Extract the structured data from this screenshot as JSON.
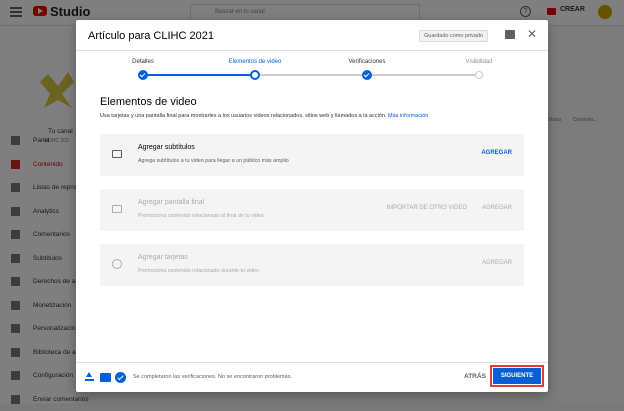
{
  "app": {
    "logo_text": "Studio",
    "search_placeholder": "Buscar en tu canal",
    "create_label": "CREAR"
  },
  "channel": {
    "name": "Tu canal",
    "subname": "CLIHC 202"
  },
  "sidebar": {
    "items": [
      {
        "label": "Panel",
        "icon": "dashboard-icon"
      },
      {
        "label": "Contenido",
        "icon": "content-icon",
        "active": true
      },
      {
        "label": "Listas de repro",
        "icon": "playlist-icon"
      },
      {
        "label": "Analytics",
        "icon": "analytics-icon"
      },
      {
        "label": "Comentarios",
        "icon": "comments-icon"
      },
      {
        "label": "Subtítulos",
        "icon": "subtitles-icon"
      },
      {
        "label": "Derechos de a",
        "icon": "copyright-icon"
      },
      {
        "label": "Monetización",
        "icon": "dollar-icon"
      },
      {
        "label": "Personalizació",
        "icon": "customize-icon"
      },
      {
        "label": "Biblioteca de a",
        "icon": "library-icon"
      },
      {
        "label": "Configuración",
        "icon": "gear-icon"
      },
      {
        "label": "Enviar comentarios",
        "icon": "feedback-icon"
      }
    ]
  },
  "background_columns": [
    "Vistas",
    "Comenta..."
  ],
  "modal": {
    "title": "Artículo para CLIHC 2021",
    "save_status": "Guardado como privado",
    "steps": [
      {
        "label": "Detalles",
        "state": "done"
      },
      {
        "label": "Elementos de video",
        "state": "current"
      },
      {
        "label": "Verificaciones",
        "state": "done"
      },
      {
        "label": "Visibilidad",
        "state": "todo"
      }
    ],
    "section_title": "Elementos de video",
    "section_desc": "Usa tarjetas y una pantalla final para mostrarles a los usuarios videos relacionados, sitios web y llamados a la acción.",
    "section_more": "Más información",
    "cards": [
      {
        "title": "Agregar subtítulos",
        "sub": "Agrega subtítulos a tu video para llegar a un público más amplio",
        "action": "AGREGAR",
        "icon": "subtitles-icon",
        "disabled": false
      },
      {
        "title": "Agregar pantalla final",
        "sub": "Promociona contenido relacionado al final de tu video",
        "action": "AGREGAR",
        "secondary": "IMPORTAR DE OTRO VIDEO",
        "icon": "end-screen-icon",
        "disabled": true
      },
      {
        "title": "Agregar tarjetas",
        "sub": "Promociona contenido relacionado durante tu video",
        "action": "AGREGAR",
        "icon": "info-icon",
        "disabled": true
      }
    ],
    "footer": {
      "status": "Se completaron las verificaciones. No se encontraron problemas.",
      "back_label": "ATRÁS",
      "next_label": "SIGUIENTE"
    }
  },
  "colors": {
    "accent": "#065fd4",
    "brand": "#ff0000",
    "highlight": "#e53935"
  }
}
